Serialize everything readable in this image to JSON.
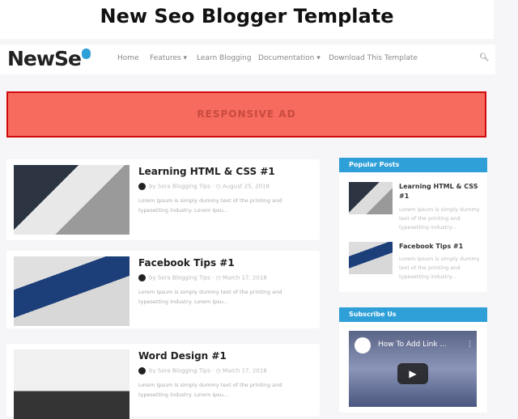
{
  "title": "New Seo Blogger Template",
  "logo": "NewSe",
  "nav": [
    {
      "label": "Home"
    },
    {
      "label": "Features ▾"
    },
    {
      "label": "Learn Blogging"
    },
    {
      "label": "Documentation ▾"
    },
    {
      "label": "Download This Template"
    }
  ],
  "ad": "RESPONSIVE AD",
  "posts": [
    {
      "title": "Learning HTML & CSS #1",
      "meta": "by Sora Blogging Tips · ◷ August 25, 2018",
      "excerpt": "Lorem Ipsum is simply dummy text of the printing and typesetting industry. Lorem Ipsu..."
    },
    {
      "title": "Facebook Tips #1",
      "meta": "by Sora Blogging Tips · ◷ March 17, 2018",
      "excerpt": "Lorem Ipsum is simply dummy text of the printing and typesetting industry. Lorem Ipsu..."
    },
    {
      "title": "Word Design #1",
      "meta": "by Sora Blogging Tips · ◷ March 17, 2018",
      "excerpt": "Lorem Ipsum is simply dummy text of the printing and typesetting industry. Lorem Ipsu..."
    }
  ],
  "popular": {
    "heading": "Popular Posts",
    "items": [
      {
        "title": "Learning HTML & CSS #1",
        "excerpt": "Lorem Ipsum is simply dummy text of the printing and typesetting industry..."
      },
      {
        "title": "Facebook Tips #1",
        "excerpt": "Lorem Ipsum is simply dummy text of the printing and typesetting industry..."
      }
    ]
  },
  "subscribe": {
    "heading": "Subscribe Us",
    "video_title": "How To Add Link ..."
  },
  "colors": {
    "accent": "#2f9fd8",
    "ad": "#f66b5e"
  }
}
